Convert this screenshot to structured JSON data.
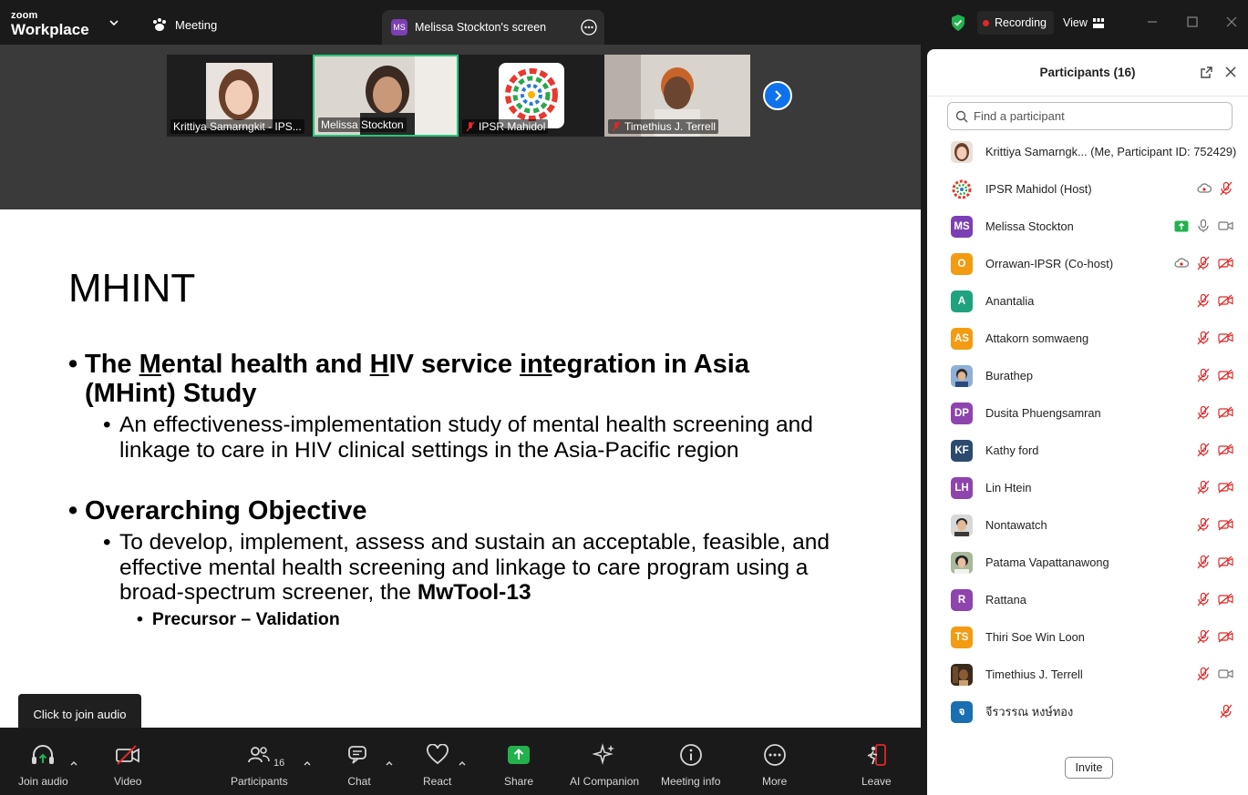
{
  "brand": {
    "line1": "zoom",
    "line2": "Workplace"
  },
  "topbar": {
    "meeting_label": "Meeting",
    "share_tab_initials": "MS",
    "share_tab_label": "Melissa Stockton's screen",
    "recording_label": "Recording",
    "view_label": "View"
  },
  "gallery": {
    "tiles": [
      {
        "name": "Krittiya Samarngkit - IPS..."
      },
      {
        "name": "Melissa Stockton"
      },
      {
        "name": "IPSR Mahidol"
      },
      {
        "name": "Timethius J. Terrell"
      }
    ]
  },
  "slide": {
    "title": "MHINT",
    "bullet1_parts": [
      "The ",
      "M",
      "ental health and ",
      "H",
      "IV service ",
      "int",
      "egration in Asia (MHint) Study"
    ],
    "bullet1_sub": "An effectiveness-implementation study of mental health screening and linkage to care in HIV clinical settings in the Asia-Pacific region",
    "bullet2": "Overarching Objective",
    "bullet2_sub": "To develop, implement, assess and sustain an acceptable, feasible, and effective mental health screening and linkage to care program using a broad-spectrum screener, the ",
    "bullet2_sub_bold": "MwTool-13",
    "bullet3": "Precursor – Validation"
  },
  "tooltip": "Click to join audio",
  "toolbar": {
    "join_audio": "Join audio",
    "video": "Video",
    "participants": "Participants",
    "participants_count": "16",
    "chat": "Chat",
    "react": "React",
    "share": "Share",
    "ai_companion": "AI Companion",
    "meeting_info": "Meeting info",
    "more": "More",
    "leave": "Leave"
  },
  "panel": {
    "title": "Participants (16)",
    "search_placeholder": "Find a participant",
    "invite": "Invite",
    "participants": [
      {
        "name": "Krittiya Samarngk... (Me, Participant ID: 752429)",
        "initials": "",
        "color": "#c9a38e"
      },
      {
        "name": "IPSR Mahidol (Host)",
        "initials": "",
        "color": "#ffffff"
      },
      {
        "name": "Melissa Stockton",
        "initials": "MS",
        "color": "#7b3fb4"
      },
      {
        "name": "Orrawan-IPSR (Co-host)",
        "initials": "O",
        "color": "#f39c12"
      },
      {
        "name": "Anantalia",
        "initials": "A",
        "color": "#1fa37f"
      },
      {
        "name": "Attakorn somwaeng",
        "initials": "AS",
        "color": "#f39c12"
      },
      {
        "name": "Burathep",
        "initials": "",
        "color": "#6b8bb0"
      },
      {
        "name": "Dusita Phuengsamran",
        "initials": "DP",
        "color": "#8e44ad"
      },
      {
        "name": "Kathy ford",
        "initials": "KF",
        "color": "#2c4a6e"
      },
      {
        "name": "Lin Htein",
        "initials": "LH",
        "color": "#8e44ad"
      },
      {
        "name": "Nontawatch",
        "initials": "",
        "color": "#8a8a8a"
      },
      {
        "name": "Patama Vapattanawong",
        "initials": "",
        "color": "#7a8a6a"
      },
      {
        "name": "Rattana",
        "initials": "R",
        "color": "#8e44ad"
      },
      {
        "name": "Thiri Soe Win Loon",
        "initials": "TS",
        "color": "#f39c12"
      },
      {
        "name": "Timethius J. Terrell",
        "initials": "",
        "color": "#5a3a20"
      },
      {
        "name": "จีรวรรณ หงษ์ทอง",
        "initials": "จ",
        "color": "#1a6fb3"
      }
    ]
  }
}
